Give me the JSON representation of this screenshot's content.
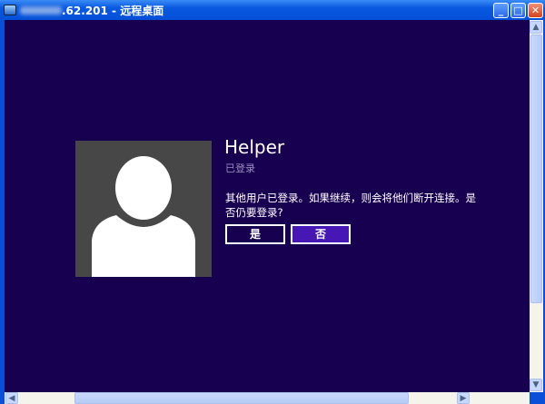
{
  "window": {
    "title": ".62.201 - 远程桌面",
    "minimize": "_",
    "maximize": "□",
    "close": "✕"
  },
  "login": {
    "user_name": "Helper",
    "status": "已登录",
    "message": "其他用户已登录。如果继续，则会将他们断开连接。是否仍要登录?",
    "yes_label": "是",
    "no_label": "否"
  },
  "colors": {
    "background": "#170050",
    "accent": "#4617b4",
    "avatar": "#474747"
  }
}
